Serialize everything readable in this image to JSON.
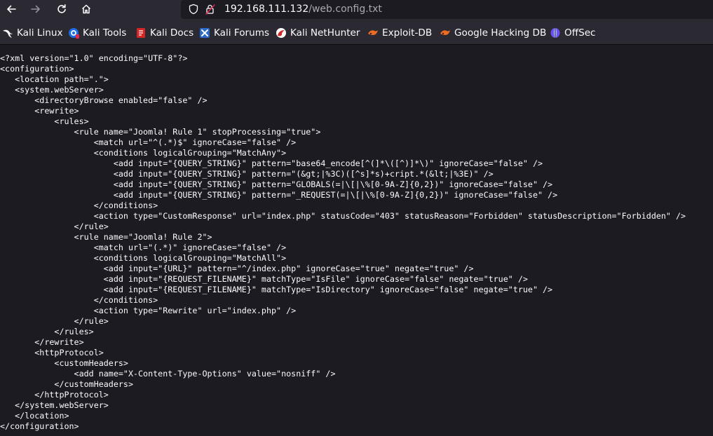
{
  "browser": {
    "url_host": "192.168.111.132",
    "url_path": "/web.config.txt"
  },
  "icons": {
    "back": "arrow-left-icon",
    "forward": "arrow-right-icon",
    "reload": "reload-icon",
    "home": "home-icon",
    "tracking": "shield-icon",
    "insecure": "lock-warning-icon"
  },
  "colors": {
    "toolbar_bg": "#2b2a33",
    "page_bg": "#1c1b22",
    "text": "#fbfbfe",
    "url_path": "#a8a8b0",
    "kali_tools": "#1d6ce0",
    "kali_docs": "#d32626",
    "kali_forums": "#2a6bc9",
    "exploit_db": "#ee6b21",
    "offsec": "#6d4ef1"
  },
  "bookmarks": [
    {
      "label": "Kali Linux",
      "icon": "kali-dragon-icon"
    },
    {
      "label": "Kali Tools",
      "icon": "kali-tools-icon"
    },
    {
      "label": "Kali Docs",
      "icon": "kali-docs-icon"
    },
    {
      "label": "Kali Forums",
      "icon": "kali-forums-icon"
    },
    {
      "label": "Kali NetHunter",
      "icon": "kali-nethunter-icon"
    },
    {
      "label": "Exploit-DB",
      "icon": "exploit-db-icon"
    },
    {
      "label": "Google Hacking DB",
      "icon": "exploit-db-icon"
    },
    {
      "label": "OffSec",
      "icon": "offsec-icon"
    }
  ],
  "document": {
    "lines": [
      "<?xml version=\"1.0\" encoding=\"UTF-8\"?>",
      "<configuration>",
      "   <location path=\".\">",
      "   <system.webServer>",
      "       <directoryBrowse enabled=\"false\" />",
      "       <rewrite>",
      "           <rules>",
      "               <rule name=\"Joomla! Rule 1\" stopProcessing=\"true\">",
      "                   <match url=\"^(.*)$\" ignoreCase=\"false\" />",
      "                   <conditions logicalGrouping=\"MatchAny\">",
      "                       <add input=\"{QUERY_STRING}\" pattern=\"base64_encode[^(]*\\([^)]*\\)\" ignoreCase=\"false\" />",
      "                       <add input=\"{QUERY_STRING}\" pattern=\"(&gt;|%3C)([^s]*s)+cript.*(&lt;|%3E)\" />",
      "                       <add input=\"{QUERY_STRING}\" pattern=\"GLOBALS(=|\\[|\\%[0-9A-Z]{0,2})\" ignoreCase=\"false\" />",
      "                       <add input=\"{QUERY_STRING}\" pattern=\"_REQUEST(=|\\[|\\%[0-9A-Z]{0,2})\" ignoreCase=\"false\" />",
      "                   </conditions>",
      "                   <action type=\"CustomResponse\" url=\"index.php\" statusCode=\"403\" statusReason=\"Forbidden\" statusDescription=\"Forbidden\" />",
      "               </rule>",
      "               <rule name=\"Joomla! Rule 2\">",
      "                   <match url=\"(.*)\" ignoreCase=\"false\" />",
      "                   <conditions logicalGrouping=\"MatchAll\">",
      "                     <add input=\"{URL}\" pattern=\"^/index.php\" ignoreCase=\"true\" negate=\"true\" />",
      "                     <add input=\"{REQUEST_FILENAME}\" matchType=\"IsFile\" ignoreCase=\"false\" negate=\"true\" />",
      "                     <add input=\"{REQUEST_FILENAME}\" matchType=\"IsDirectory\" ignoreCase=\"false\" negate=\"true\" />",
      "                   </conditions>",
      "                   <action type=\"Rewrite\" url=\"index.php\" />",
      "               </rule>",
      "           </rules>",
      "       </rewrite>",
      "       <httpProtocol>",
      "           <customHeaders>",
      "               <add name=\"X-Content-Type-Options\" value=\"nosniff\" />",
      "           </customHeaders>",
      "       </httpProtocol>",
      "   </system.webServer>",
      "   </location>",
      "</configuration>"
    ]
  }
}
